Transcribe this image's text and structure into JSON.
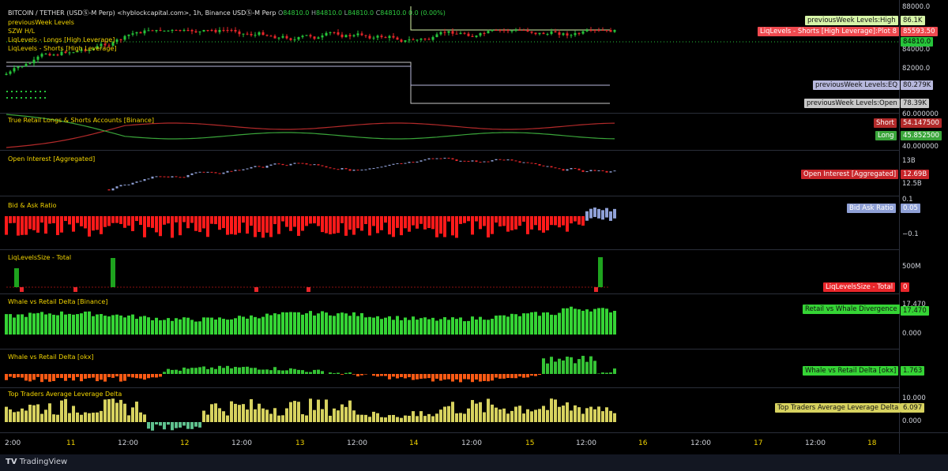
{
  "header": {
    "symbol_line": "BITCOIN / TETHER (USDⓈ-M Perp) <hyblockcapital.com>, 1h, Binance USDⓈ-M Perp",
    "o_label": "O",
    "o_val": "84810.0",
    "h_label": "H",
    "h_val": "84810.0",
    "l_label": "L",
    "l_val": "84810.0",
    "c_label": "C",
    "c_val": "84810.0",
    "chg": "0.0 (0.00%)",
    "ind1": "previousWeek Levels",
    "ind2": "SZW H/L",
    "ind3": "LiqLevels - Longs [High Leverage]",
    "ind4": "LiqLevels - Shorts [High Leverage]"
  },
  "panes": {
    "retail": "True Retail Longs & Shorts Accounts [Binance]",
    "oi": "Open Interest [Aggregated]",
    "bidask": "Bid & Ask Ratio",
    "liqsize": "LiqLevelsSize - Total",
    "whale_binance": "Whale vs Retail Delta [Binance]",
    "whale_okx": "Whale vs Retail Delta [okx]",
    "toptraders": "Top Traders Average Leverage Delta"
  },
  "right_labels": {
    "pw_high_name": "previousWeek Levels:High",
    "pw_high_val": "86.1K",
    "liq_shorts_name": "LiqLevels - Shorts [High Leverage]:Plot 8",
    "liq_shorts_val": "85593.50",
    "last_price": "84810.0",
    "pw_eq_name": "previousWeek Levels:EQ",
    "pw_eq_val": "80.279K",
    "pw_open_name": "previousWeek Levels:Open",
    "pw_open_val": "78.39K",
    "short_name": "Short",
    "short_val": "54.147500",
    "long_name": "Long",
    "long_val": "45.852500",
    "oi_name": "Open Interest [Aggregated]",
    "oi_val": "12.69B",
    "bidask_name": "Bid Ask Ratio",
    "bidask_val": "0.05",
    "liqsize_name": "LiqLevelsSize - Total",
    "liqsize_val": "0",
    "divergence_name": "Retail vs Whale Divergence",
    "divergence_val": "17.470",
    "okx_name": "Whale vs Retail Delta [okx]",
    "okx_val": "1.763",
    "top_name": "Top Traders Average Leverage Delta",
    "top_val": "6.097"
  },
  "axis_ticks": {
    "price_88000": "88000.0",
    "price_84000": "84000.0",
    "price_82000": "82000.0",
    "retail_60": "60.000000",
    "retail_40": "40.000000",
    "oi_13": "13B",
    "oi_125": "12.5B",
    "ba_01": "0.1",
    "ba_m01": "−0.1",
    "ls_500": "500M",
    "wb_1747": "17.470",
    "wb_0": "0.000",
    "top_10": "10.000",
    "top_0": "0.000"
  },
  "x_axis": [
    "2:00",
    "11",
    "12:00",
    "12",
    "12:00",
    "13",
    "12:00",
    "14",
    "12:00",
    "15",
    "12:00",
    "16",
    "12:00",
    "17",
    "12:00",
    "18"
  ],
  "footer": {
    "brand": "TradingView"
  },
  "colors": {
    "up": "#26c43a",
    "down": "#e8262a",
    "pw_high": "#d7f5a8",
    "liq_shorts": "#f04a50",
    "pw_eq": "#b7b8dd",
    "pw_open": "#c8c8c8",
    "short": "#b22a2a",
    "long": "#3aa53a",
    "oi": "#e8262a",
    "bidask": "#8fa0d6",
    "divergence": "#35d435",
    "top": "#d7d25f"
  }
}
